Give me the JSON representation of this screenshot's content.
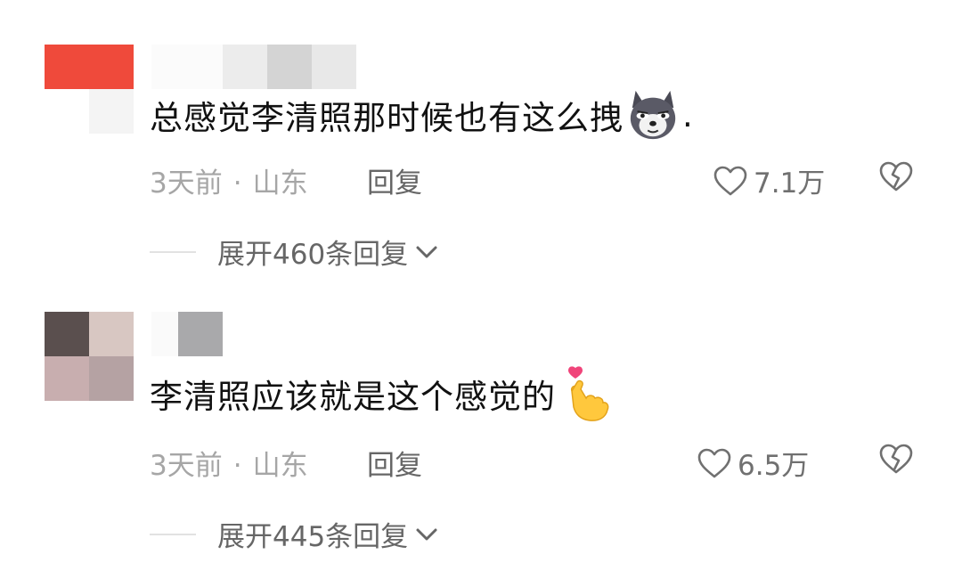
{
  "comments": [
    {
      "text": "总感觉李清照那时候也有这么拽",
      "emoji": "wolf-doge-emoji",
      "trailing": ".",
      "time": "3天前",
      "separator": "·",
      "location": "山东",
      "reply_label": "回复",
      "likes": "7.1万",
      "expand_label": "展开460条回复"
    },
    {
      "text": "李清照应该就是这个感觉的",
      "emoji": "finger-heart-emoji",
      "trailing": "",
      "time": "3天前",
      "separator": "·",
      "location": "山东",
      "reply_label": "回复",
      "likes": "6.5万",
      "expand_label": "展开445条回复"
    }
  ]
}
